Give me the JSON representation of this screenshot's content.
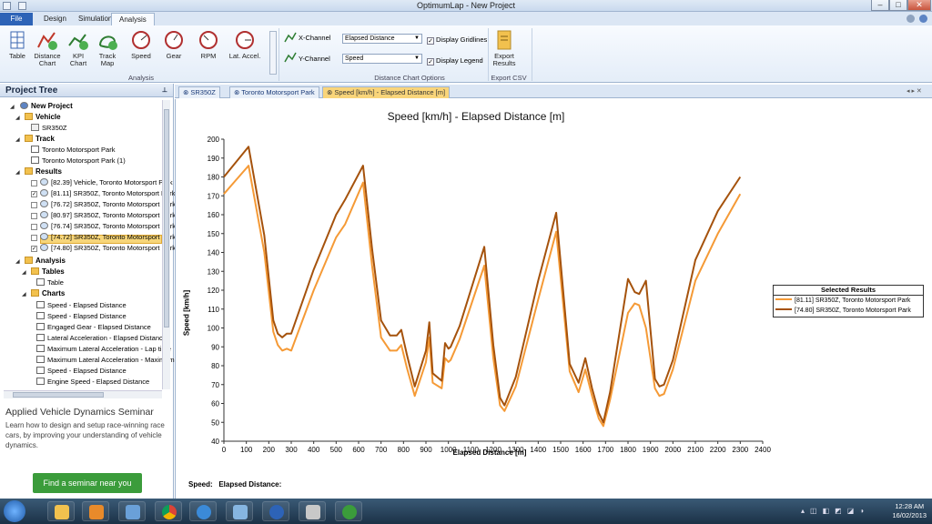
{
  "window": {
    "title": "OptimumLap - New Project"
  },
  "menu_tabs": [
    "File",
    "Design",
    "Simulation",
    "Analysis"
  ],
  "ribbon": {
    "analysis_buttons": [
      "Table",
      "Distance Chart",
      "KPI Chart",
      "Track Map"
    ],
    "analysis_group": "Analysis",
    "chart_buttons": [
      "Speed",
      "Gear",
      "RPM",
      "Lat. Accel."
    ],
    "x_channel_label": "X-Channel",
    "y_channel_label": "Y-Channel",
    "x_channel_value": "Elapsed Distance",
    "y_channel_value": "Speed",
    "display_gridlines": "Display Gridlines",
    "display_legend": "Display Legend",
    "options_group": "Distance Chart Options",
    "export_button": "Export Results",
    "export_group": "Export CSV"
  },
  "tree": {
    "header": "Project Tree",
    "root": "New Project",
    "vehicle_folder": "Vehicle",
    "vehicle": "SR350Z",
    "track_folder": "Track",
    "tracks": [
      "Toronto Motorsport Park",
      "Toronto Motorsport Park (1)"
    ],
    "results_folder": "Results",
    "results": [
      "[82.39] Vehicle, Toronto Motorsport Park",
      "[81.11] SR350Z, Toronto Motorsport Park",
      "[76.72] SR350Z, Toronto Motorsport Park",
      "[80.97] SR350Z, Toronto Motorsport Park",
      "[76.74] SR350Z, Toronto Motorsport Park",
      "[74.72] SR350Z, Toronto Motorsport Park",
      "[74.80] SR350Z, Toronto Motorsport Park"
    ],
    "analysis_folder": "Analysis",
    "tables_folder": "Tables",
    "table": "Table",
    "charts_folder": "Charts",
    "charts": [
      "Speed - Elapsed Distance",
      "Speed - Elapsed Distance",
      "Engaged Gear - Elapsed Distance",
      "Lateral Acceleration - Elapsed Distance",
      "Maximum Lateral Acceleration - Lap time",
      "Maximum Lateral Acceleration - Maximum",
      "Speed - Elapsed Distance",
      "Engine Speed - Elapsed Distance"
    ]
  },
  "ad": {
    "heading": "Applied Vehicle Dynamics Seminar",
    "body": "Learn how to design and setup race-winning race cars, by improving your understanding of vehicle dynamics.",
    "button": "Find a seminar near you"
  },
  "doc_tabs": [
    "SR350Z",
    "Toronto Motorsport Park",
    "Speed [km/h] - Elapsed Distance [m]"
  ],
  "readout": {
    "speed": "Speed:",
    "distance": "Elapsed Distance:"
  },
  "taskbar": {
    "time": "12:28 AM",
    "date": "16/02/2013"
  },
  "chart_data": {
    "type": "line",
    "title": "Speed [km/h] - Elapsed Distance [m]",
    "xlabel": "Elapsed Distance [m]",
    "ylabel": "Speed [km/h]",
    "xlim": [
      0,
      2400
    ],
    "ylim": [
      40,
      200
    ],
    "xticks": [
      0,
      100,
      200,
      300,
      400,
      500,
      600,
      700,
      800,
      900,
      1000,
      1100,
      1200,
      1300,
      1400,
      1500,
      1600,
      1700,
      1800,
      1900,
      2000,
      2100,
      2200,
      2300,
      2400
    ],
    "yticks": [
      40,
      50,
      60,
      70,
      80,
      90,
      100,
      110,
      120,
      130,
      140,
      150,
      160,
      170,
      180,
      190,
      200
    ],
    "grid": false,
    "legend": {
      "title": "Selected Results",
      "position": "right"
    },
    "series": [
      {
        "name": "[81.11] SR350Z, Toronto Motorsport Park",
        "color": "#f59a36",
        "x": [
          0,
          110,
          180,
          220,
          240,
          260,
          280,
          300,
          400,
          500,
          540,
          620,
          660,
          700,
          740,
          770,
          790,
          815,
          850,
          900,
          915,
          930,
          970,
          985,
          1000,
          1010,
          1050,
          1160,
          1200,
          1230,
          1250,
          1300,
          1400,
          1480,
          1540,
          1580,
          1610,
          1640,
          1670,
          1690,
          1720,
          1800,
          1830,
          1850,
          1880,
          1920,
          1940,
          1960,
          2000,
          2100,
          2200,
          2300
        ],
        "y": [
          171,
          186,
          140,
          98,
          91,
          88,
          89,
          88,
          120,
          148,
          155,
          177,
          133,
          95,
          88,
          88,
          91,
          79,
          64,
          82,
          95,
          71,
          68,
          84,
          82,
          83,
          94,
          133,
          84,
          59,
          56,
          69,
          115,
          151,
          77,
          66,
          78,
          64,
          52,
          48,
          62,
          108,
          113,
          112,
          100,
          68,
          64,
          65,
          78,
          125,
          150,
          171
        ]
      },
      {
        "name": "[74.80] SR350Z, Toronto Motorsport Park",
        "color": "#a5520c",
        "x": [
          0,
          110,
          180,
          220,
          240,
          260,
          280,
          300,
          400,
          500,
          540,
          620,
          660,
          700,
          740,
          770,
          790,
          815,
          850,
          900,
          915,
          930,
          970,
          985,
          1000,
          1010,
          1050,
          1160,
          1200,
          1230,
          1250,
          1300,
          1400,
          1480,
          1540,
          1580,
          1610,
          1640,
          1670,
          1690,
          1720,
          1800,
          1830,
          1850,
          1880,
          1920,
          1940,
          1960,
          2000,
          2100,
          2200,
          2300
        ],
        "y": [
          180,
          196,
          149,
          104,
          97,
          95,
          97,
          97,
          131,
          160,
          168,
          186,
          142,
          104,
          96,
          96,
          99,
          86,
          69,
          88,
          103,
          76,
          72,
          92,
          89,
          90,
          101,
          143,
          91,
          63,
          59,
          74,
          125,
          161,
          81,
          71,
          84,
          68,
          55,
          50,
          66,
          126,
          119,
          118,
          125,
          73,
          69,
          70,
          83,
          136,
          162,
          180
        ]
      }
    ]
  }
}
